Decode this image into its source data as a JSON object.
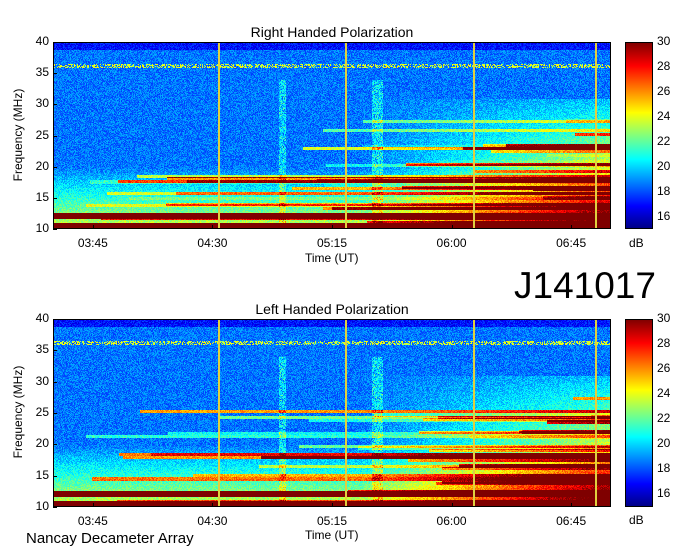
{
  "chart_data": [
    {
      "type": "heatmap",
      "title": "Right Handed Polarization",
      "xlabel": "Time (UT)",
      "ylabel": "Frequency (MHz)",
      "x_ticks": [
        "03:45",
        "04:30",
        "05:15",
        "06:00",
        "06:45"
      ],
      "y_ticks": [
        "10",
        "15",
        "20",
        "25",
        "30",
        "35",
        "40"
      ],
      "ylim": [
        10,
        40
      ],
      "xlim": [
        "03:30",
        "07:00"
      ],
      "marker_lines_ut": [
        "04:32",
        "05:20",
        "06:08",
        "06:54"
      ],
      "colorbar": {
        "label": "dB",
        "ticks": [
          "16",
          "18",
          "20",
          "22",
          "24",
          "26",
          "28",
          "30"
        ],
        "range": [
          15,
          30
        ]
      }
    },
    {
      "type": "heatmap",
      "title": "Left Handed Polarization",
      "xlabel": "Time (UT)",
      "ylabel": "Frequency (MHz)",
      "x_ticks": [
        "03:45",
        "04:30",
        "05:15",
        "06:00",
        "06:45"
      ],
      "y_ticks": [
        "10",
        "15",
        "20",
        "25",
        "30",
        "35",
        "40"
      ],
      "ylim": [
        10,
        40
      ],
      "xlim": [
        "03:30",
        "07:00"
      ],
      "marker_lines_ut": [
        "04:32",
        "05:20",
        "06:08",
        "06:54"
      ],
      "colorbar": {
        "label": "dB",
        "ticks": [
          "16",
          "18",
          "20",
          "22",
          "24",
          "26",
          "28",
          "30"
        ],
        "range": [
          15,
          30
        ]
      }
    }
  ],
  "observation_id": "J141017",
  "instrument": "Nancay Decameter Array",
  "colors": {
    "marker_line": "#e0d040",
    "colormap": "jet"
  }
}
